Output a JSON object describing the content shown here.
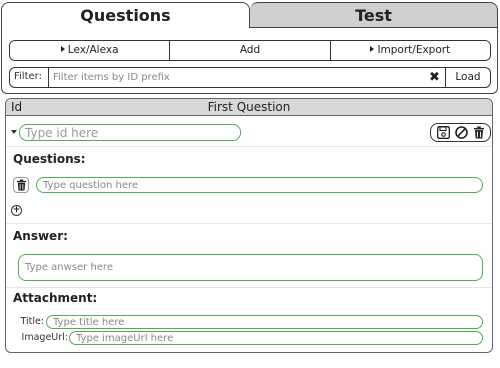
{
  "tabs": [
    {
      "label": "Questions",
      "active": true
    },
    {
      "label": "Test",
      "active": false
    }
  ],
  "toolbar": {
    "lex_label": "Lex/Alexa",
    "add_label": "Add",
    "import_export_label": "Import/Export"
  },
  "filter": {
    "label": "Filter:",
    "placeholder": "Filter items by ID prefix",
    "value": "",
    "clear_glyph": "✖",
    "load_label": "Load"
  },
  "list": {
    "col_id": "Id",
    "col_first_question": "First Question"
  },
  "editor": {
    "id_placeholder": "Type id here",
    "questions_label": "Questions:",
    "question_placeholder": "Type question here",
    "add_glyph": "+",
    "answer_label": "Answer:",
    "answer_placeholder": "Type anwser here",
    "attachment_label": "Attachment:",
    "title_label": "Title:",
    "title_placeholder": "Type title here",
    "imageurl_label": "ImageUrl:",
    "imageurl_placeholder": "Type imageUrl here"
  },
  "icons": {
    "save": "save-icon",
    "cancel": "cancel-icon",
    "delete": "trash-icon"
  },
  "colors": {
    "accent_green": "#4caf50",
    "inactive_tab": "#cfcfcf",
    "header_gray": "#d8d8d8"
  }
}
